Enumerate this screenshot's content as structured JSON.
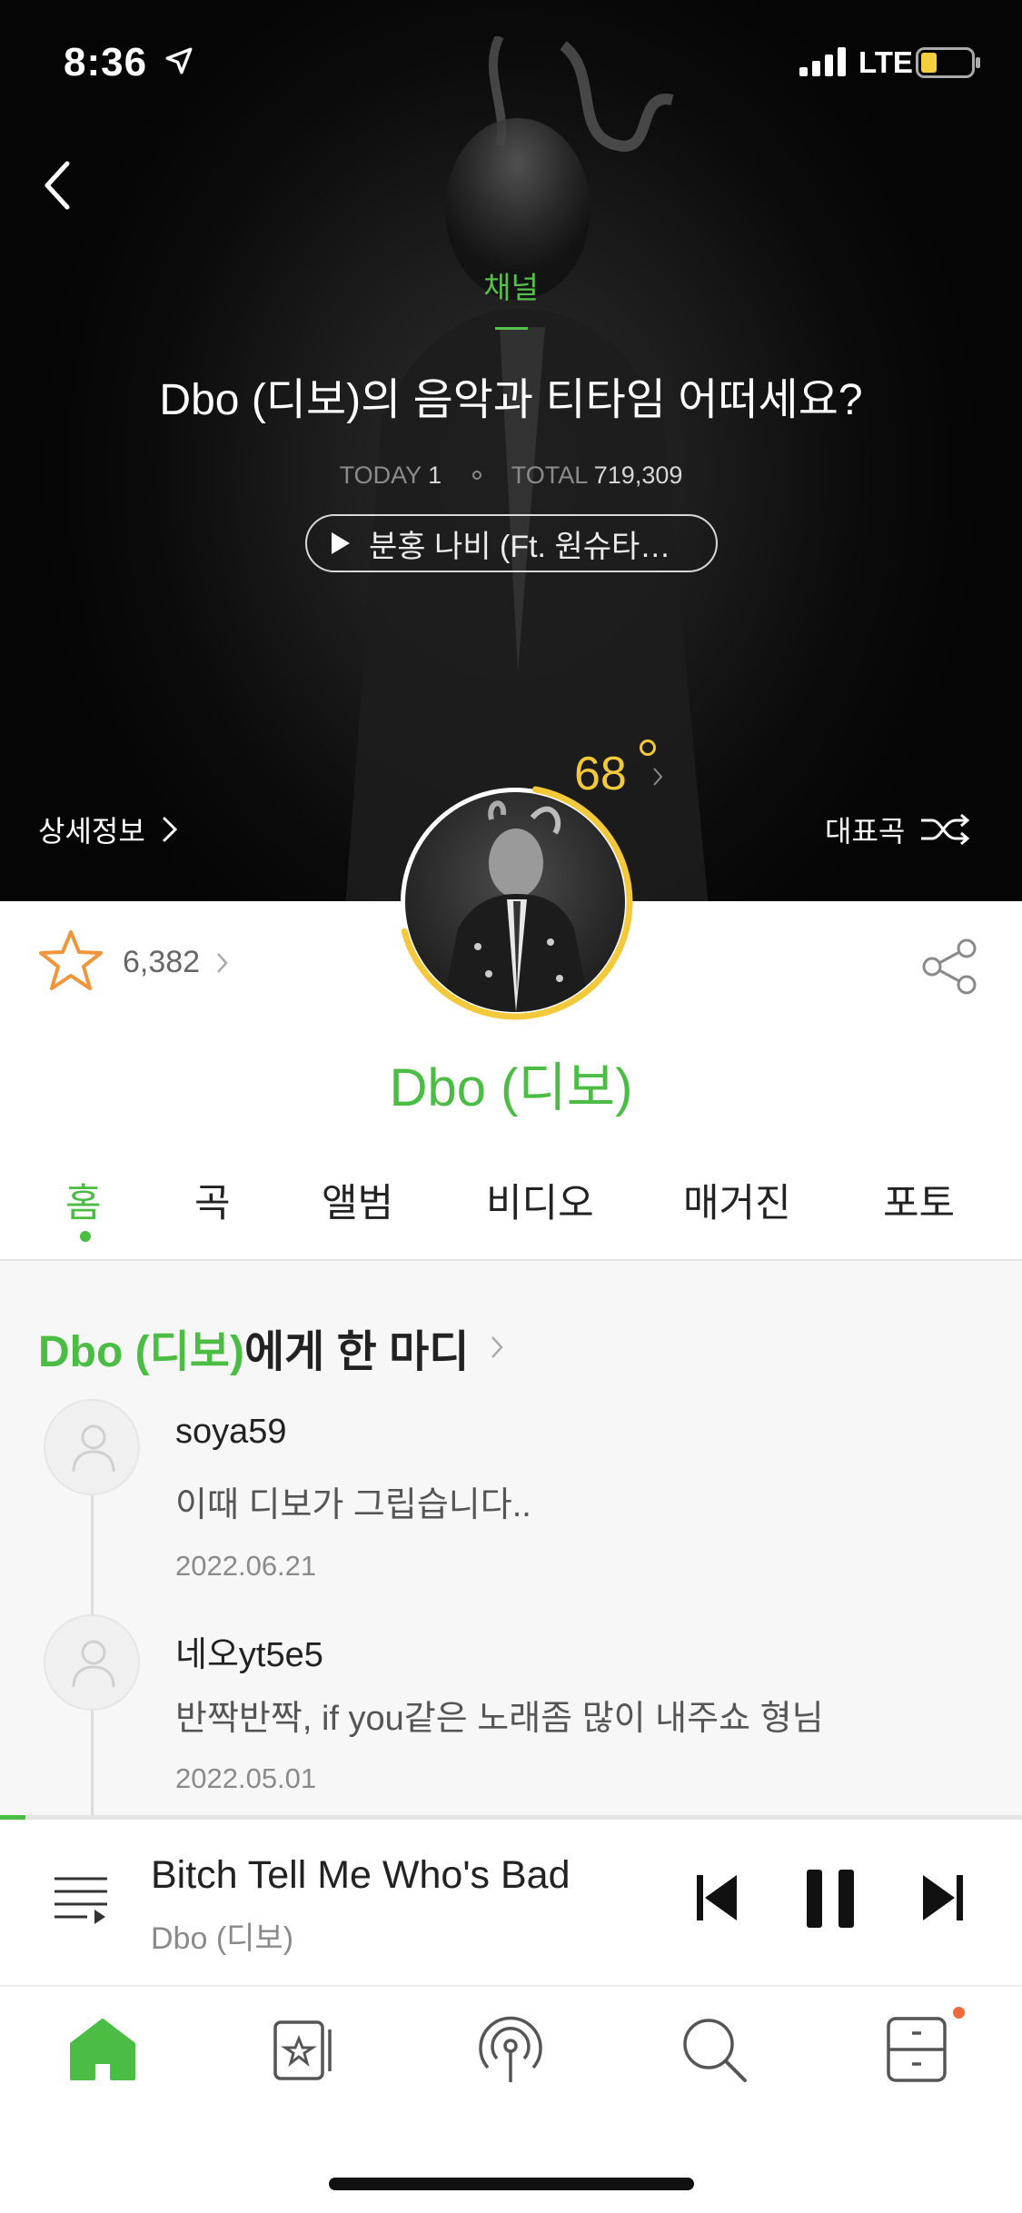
{
  "status_bar": {
    "time": "8:36",
    "network": "LTE",
    "icons": [
      "location-arrow-icon",
      "signal-icon",
      "battery-icon"
    ]
  },
  "hero": {
    "channel_label": "채널",
    "title": "Dbo (디보)의 음악과 티타임 어떠세요?",
    "today_label": "TODAY",
    "today_value": "1",
    "total_label": "TOTAL",
    "total_value": "719,309",
    "song_pill": "분홍 나비 (Ft. 원슈타…",
    "detail_link": "상세정보",
    "rep_song": "대표곡",
    "temperature": "68"
  },
  "profile": {
    "likes": "6,382",
    "artist_name": "Dbo (디보)",
    "temperature_fraction": 0.68
  },
  "tabs": [
    {
      "label": "홈",
      "active": true
    },
    {
      "label": "곡",
      "active": false
    },
    {
      "label": "앨범",
      "active": false
    },
    {
      "label": "비디오",
      "active": false
    },
    {
      "label": "매거진",
      "active": false
    },
    {
      "label": "포토",
      "active": false
    }
  ],
  "comments": {
    "heading_artist": "Dbo (디보)",
    "heading_suffix": "에게 한 마디",
    "items": [
      {
        "user": "soya59",
        "text": "이때 디보가 그립습니다..",
        "date": "2022.06.21"
      },
      {
        "user": "네오yt5e5",
        "text": "반짝반짝, if you같은 노래좀 많이 내주쇼 형님",
        "date": "2022.05.01"
      }
    ]
  },
  "player": {
    "title": "Bitch Tell Me Who's Bad",
    "artist": "Dbo (디보)",
    "progress_fraction": 0.025
  },
  "bottom_nav": [
    {
      "name": "home",
      "icon": "home-icon",
      "active": true
    },
    {
      "name": "my-music",
      "icon": "star-card-icon",
      "active": false
    },
    {
      "name": "podcast",
      "icon": "broadcast-icon",
      "active": false
    },
    {
      "name": "search",
      "icon": "search-icon",
      "active": false
    },
    {
      "name": "storage",
      "icon": "drawer-icon",
      "active": false,
      "badge": true
    }
  ],
  "colors": {
    "accent": "#4cbd44",
    "temperature": "#f3c93b",
    "badge": "#ef6b3a"
  }
}
